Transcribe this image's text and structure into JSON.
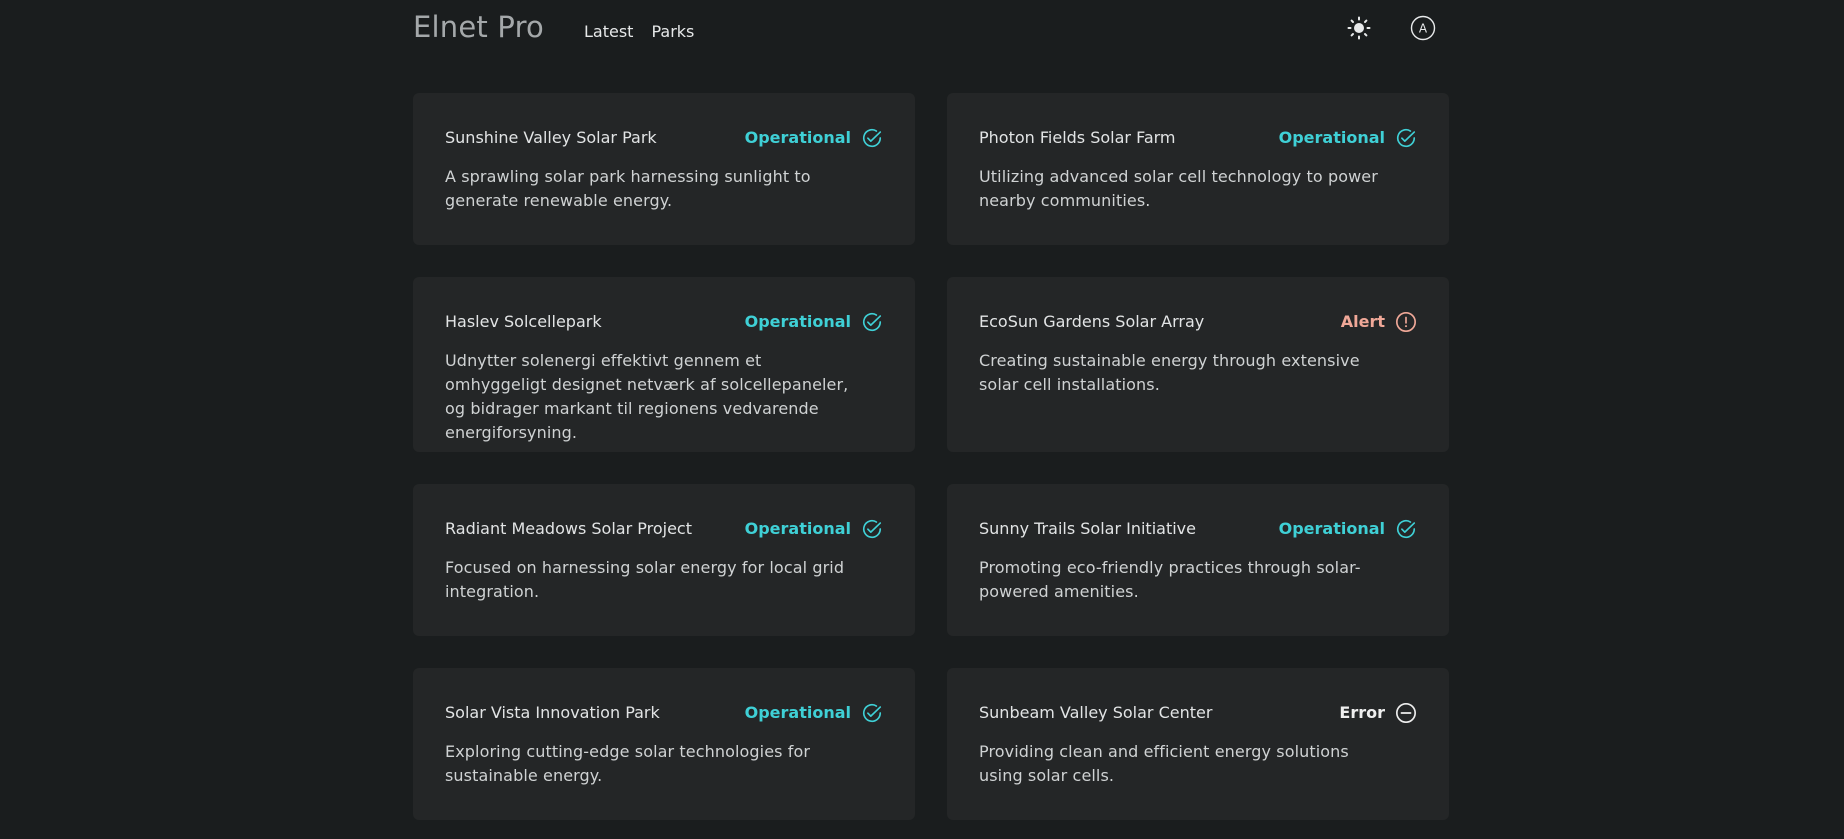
{
  "header": {
    "brand": "Elnet Pro",
    "nav": [
      "Latest",
      "Parks"
    ],
    "theme_icon": "sun-icon",
    "avatar_icon": "user-a-icon",
    "avatar_letter": "A"
  },
  "colors": {
    "background": "#1a1d1e",
    "card": "#242627",
    "operational": "#3fd0d6",
    "alert": "#f0a898",
    "error": "#eeeeee"
  },
  "parks": [
    {
      "name": "Sunshine Valley Solar Park",
      "status": "Operational",
      "status_kind": "operational",
      "status_icon": "check-circle-icon",
      "description": "A sprawling solar park harnessing sunlight to generate renewable energy."
    },
    {
      "name": "Photon Fields Solar Farm",
      "status": "Operational",
      "status_kind": "operational",
      "status_icon": "check-circle-icon",
      "description": "Utilizing advanced solar cell technology to power nearby communities."
    },
    {
      "name": "Haslev Solcellepark",
      "status": "Operational",
      "status_kind": "operational",
      "status_icon": "check-circle-icon",
      "description": "Udnytter solenergi effektivt gennem et omhyggeligt designet netværk af solcellepaneler, og bidrager markant til regionens vedvarende energiforsyning."
    },
    {
      "name": "EcoSun Gardens Solar Array",
      "status": "Alert",
      "status_kind": "alert",
      "status_icon": "exclamation-circle-icon",
      "description": "Creating sustainable energy through extensive solar cell installations."
    },
    {
      "name": "Radiant Meadows Solar Project",
      "status": "Operational",
      "status_kind": "operational",
      "status_icon": "check-circle-icon",
      "description": "Focused on harnessing solar energy for local grid integration."
    },
    {
      "name": "Sunny Trails Solar Initiative",
      "status": "Operational",
      "status_kind": "operational",
      "status_icon": "check-circle-icon",
      "description": "Promoting eco-friendly practices through solar-powered amenities."
    },
    {
      "name": "Solar Vista Innovation Park",
      "status": "Operational",
      "status_kind": "operational",
      "status_icon": "check-circle-icon",
      "description": "Exploring cutting-edge solar technologies for sustainable energy."
    },
    {
      "name": "Sunbeam Valley Solar Center",
      "status": "Error",
      "status_kind": "error",
      "status_icon": "minus-circle-icon",
      "description": "Providing clean and efficient energy solutions using solar cells."
    }
  ]
}
